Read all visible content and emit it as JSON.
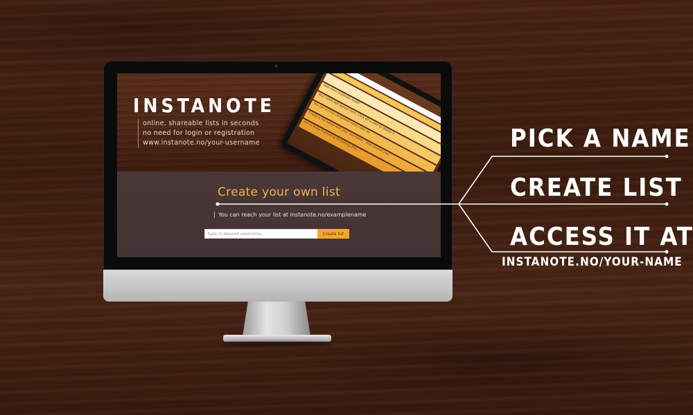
{
  "screen": {
    "brand": "INSTANOTE",
    "tagline": [
      "online, shareable lists in seconds",
      "no need for login or registration",
      "www.instanote.no/your-username"
    ],
    "tablet": {
      "title": "instanote",
      "rows": [
        "",
        "",
        "",
        "How does instanote work?",
        "Your notes will appear here. Click on a note to delete it.",
        "You can access completed notes later on",
        "Create a list below with your username - then choose your",
        "Let us know if showing list setting this..."
      ]
    },
    "create_heading": "Create your own list",
    "reach_text": "You can reach your list at instanote.no/examplename",
    "username_placeholder": "type in desired username",
    "create_button": "Create list"
  },
  "callouts": {
    "step1": "PICK A NAME",
    "step2": "CREATE LIST",
    "step3": "ACCESS IT AT",
    "step3_url": "INSTANOTE.NO/YOUR-NAME"
  },
  "colors": {
    "accent": "#f3a72e",
    "heading_accent": "#f2b348",
    "panel": "#463536",
    "wood": "#4a2415"
  }
}
